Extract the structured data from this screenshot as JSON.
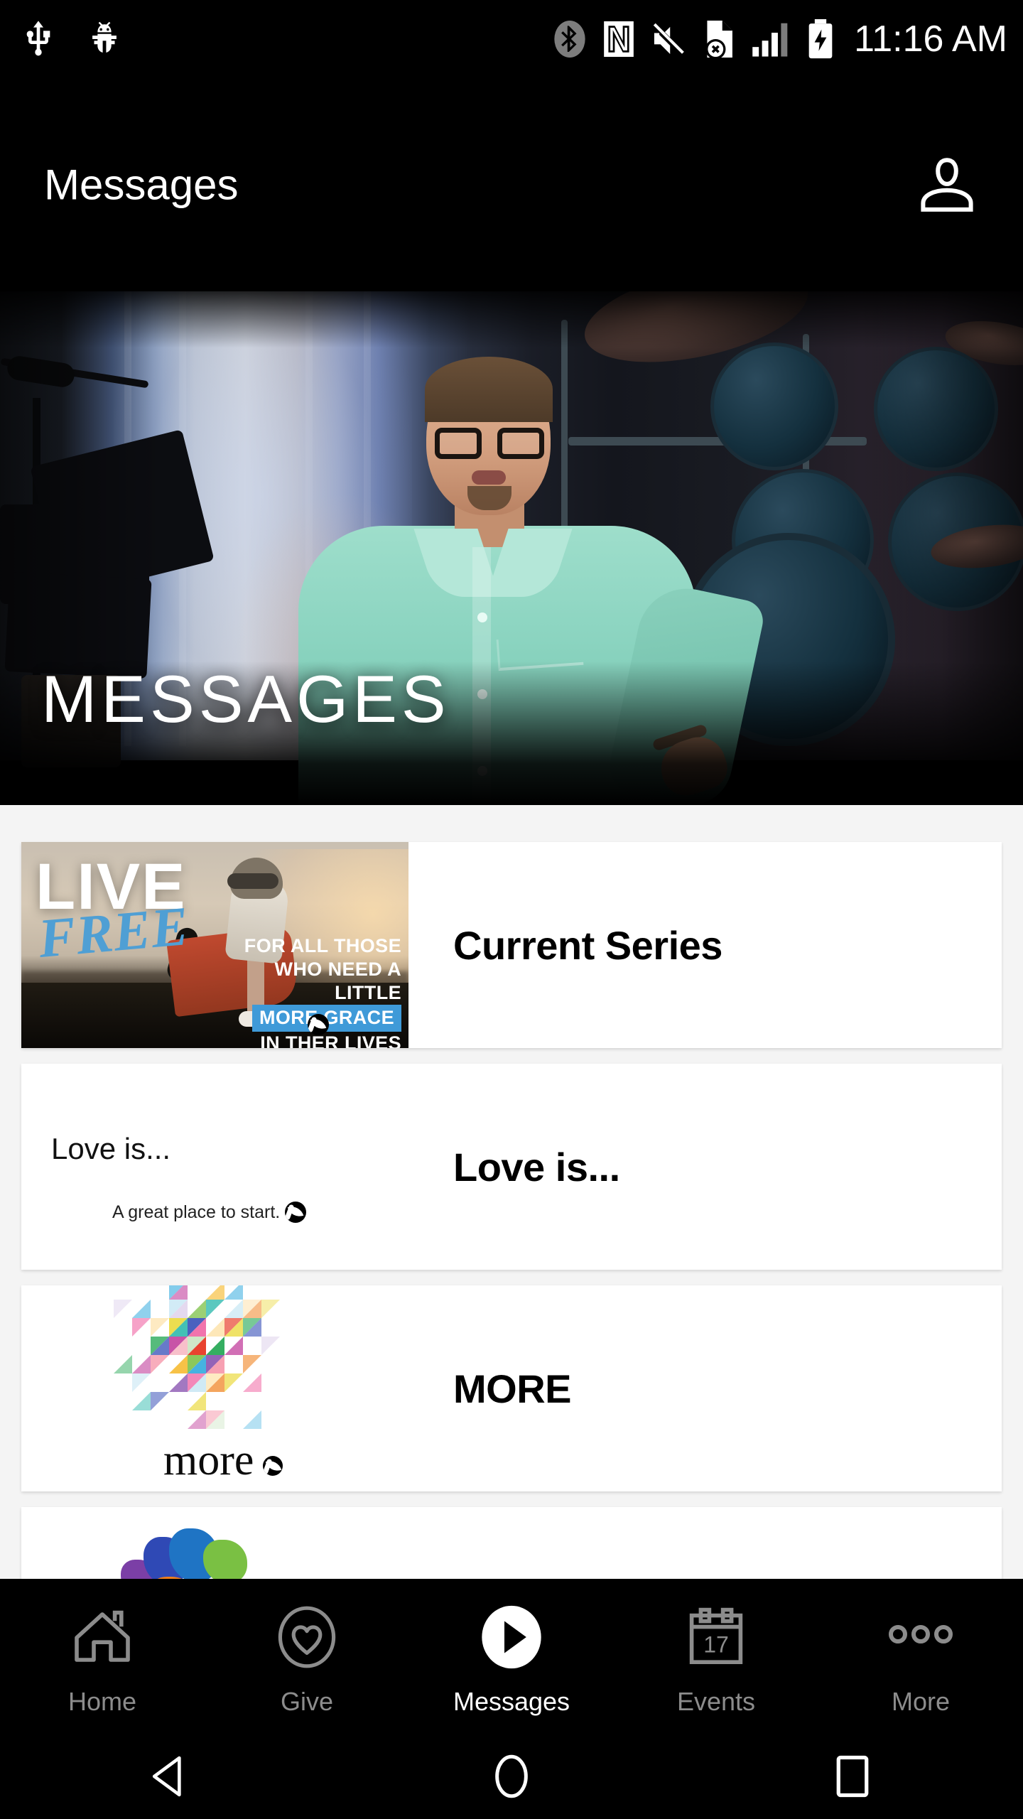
{
  "status_bar": {
    "time": "11:16 AM",
    "icons_left": [
      "usb-icon",
      "android-debug-bug-icon"
    ],
    "icons_right": [
      "bluetooth-icon",
      "nfc-icon",
      "volume-muted-icon",
      "sim-card-error-icon",
      "cellular-signal-icon",
      "battery-charging-icon"
    ]
  },
  "header": {
    "title": "Messages",
    "profile_icon": "person-icon"
  },
  "hero": {
    "caption": "MESSAGES",
    "alt": "pastor in teal shirt speaking on stage with drum kit"
  },
  "list": {
    "items": [
      {
        "title": "Current Series",
        "thumb": {
          "kind": "live-free-artwork",
          "headline": "LIVE",
          "script": "FREE",
          "line1": "FOR ALL THOSE",
          "line2": "WHO NEED A LITTLE",
          "line3": "MORE GRACE",
          "line4": "IN THER LIVES",
          "accent": "#3f9ad8",
          "logo": "leaf-logo"
        }
      },
      {
        "title": "Love is...",
        "thumb": {
          "kind": "love-is-artwork",
          "headline": "Love is...",
          "subhead": "A great place to start.",
          "logo": "leaf-logo"
        }
      },
      {
        "title": "MORE",
        "thumb": {
          "kind": "more-mosaic-artwork",
          "wordmark": "more",
          "logo": "leaf-logo"
        }
      },
      {
        "title": "",
        "thumb": {
          "kind": "colorful-blob-artwork"
        }
      }
    ]
  },
  "tabbar": {
    "active": "Messages",
    "tabs": [
      {
        "label": "Home",
        "icon": "home-icon"
      },
      {
        "label": "Give",
        "icon": "heart-circle-icon"
      },
      {
        "label": "Messages",
        "icon": "play-circle-icon"
      },
      {
        "label": "Events",
        "icon": "calendar-icon",
        "badge": "17"
      },
      {
        "label": "More",
        "icon": "ellipsis-icon"
      }
    ]
  },
  "android_nav": {
    "back": "back-triangle-icon",
    "home": "home-circle-icon",
    "recents": "recents-square-icon"
  },
  "colors": {
    "app_bar_bg": "#000000",
    "page_bg": "#f4f4f4",
    "card_bg": "#ffffff",
    "accent_blue": "#3f9ad8",
    "tab_inactive": "#8c8c8c",
    "tab_active": "#ffffff"
  }
}
